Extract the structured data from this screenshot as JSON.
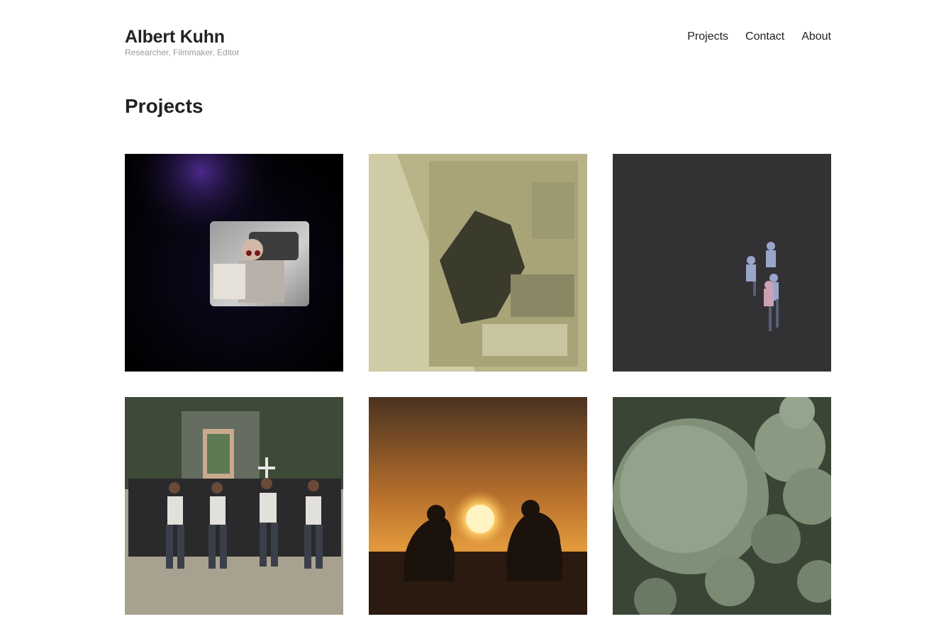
{
  "header": {
    "site_title": "Albert Kuhn",
    "tagline": "Researcher, Filmmaker, Editor",
    "nav": [
      {
        "label": "Projects"
      },
      {
        "label": "Contact"
      },
      {
        "label": "About"
      }
    ]
  },
  "main": {
    "page_title": "Projects",
    "projects": [
      {
        "thumbnail": "man-reading-in-dark-frame"
      },
      {
        "thumbnail": "sepia-blurred-figure"
      },
      {
        "thumbnail": "aerial-children-circle"
      },
      {
        "thumbnail": "religious-procession"
      },
      {
        "thumbnail": "sunset-silhouettes"
      },
      {
        "thumbnail": "green-mold-macro"
      }
    ]
  }
}
